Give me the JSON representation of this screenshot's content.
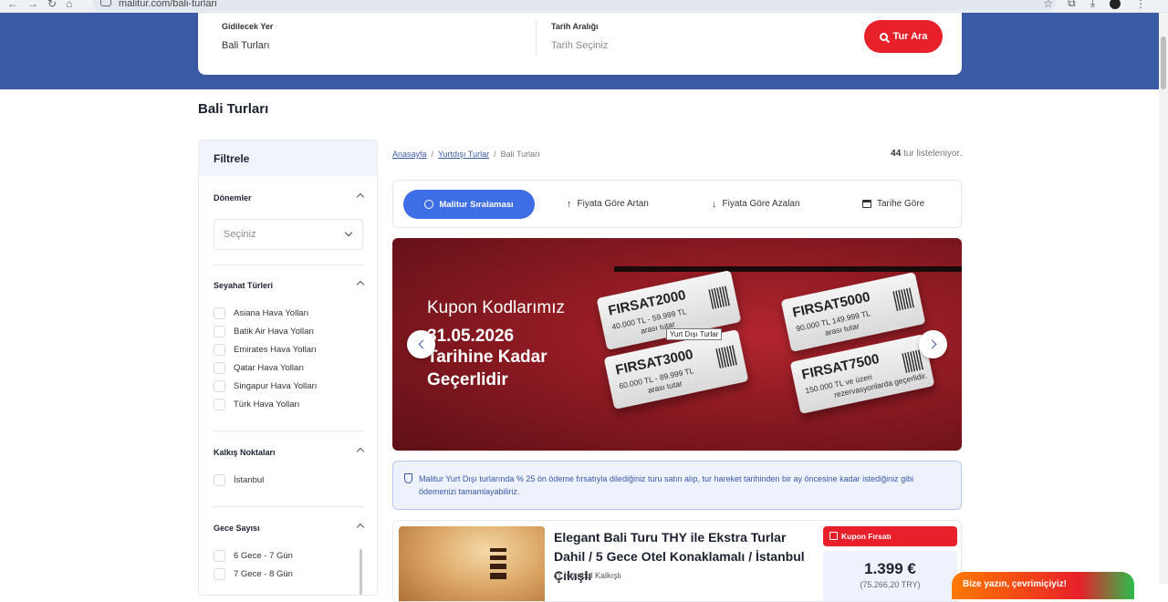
{
  "browser": {
    "url": "malitur.com/bali-turlari"
  },
  "search": {
    "destination_label": "Gidilecek Yer",
    "destination_value": "Bali Turları",
    "date_label": "Tarih Aralığı",
    "date_placeholder": "Tarih Seçiniz",
    "button_label": "Tur Ara"
  },
  "page": {
    "title": "Bali Turları"
  },
  "filters": {
    "heading": "Filtrele",
    "periods": {
      "title": "Dönemler",
      "select_placeholder": "Seçiniz"
    },
    "travel_types": {
      "title": "Seyahat Türleri",
      "options": [
        "Asiana Hava Yolları",
        "Batik Air Hava Yolları",
        "Emirates Hava Yolları",
        "Qatar Hava Yolları",
        "Singapur Hava Yolları",
        "Türk Hava Yolları"
      ]
    },
    "departure_points": {
      "title": "Kalkış Noktaları",
      "options": [
        "İstanbul"
      ]
    },
    "nights": {
      "title": "Gece Sayısı",
      "options": [
        "6 Gece - 7 Gün",
        "7 Gece - 8 Gün"
      ]
    }
  },
  "breadcrumb": {
    "home": "Anasayfa",
    "sep": "/",
    "abroad": "Yurtdışı Turlar",
    "current": "Bali Turları"
  },
  "results": {
    "count": "44",
    "suffix": "tur listeleniyor."
  },
  "sorting": {
    "active": "Malitur Sıralaması",
    "price_asc": "Fiyata Göre Artan",
    "price_desc": "Fiyata Göre Azalan",
    "by_date": "Tarihe Göre"
  },
  "banner": {
    "line1": "Kupon Kodlarımız",
    "line2": "31.05.2026",
    "line3": "Tarihine Kadar",
    "line4": "Geçerlidir",
    "tooltip": "Yurt Dışı Turlar",
    "coupons": [
      {
        "code": "FIRSAT2000",
        "range": "40.000 TL - 59.999 TL",
        "note": "arası tutar"
      },
      {
        "code": "FIRSAT3000",
        "range": "60.000 TL - 89.999 TL",
        "note": "arası tutar"
      },
      {
        "code": "FIRSAT5000",
        "range": "90.000 TL 149.999 TL",
        "note": "arası tutar"
      },
      {
        "code": "FIRSAT7500",
        "range": "150.000 TL ve üzeri",
        "note": "rezervasyonlarda geçerlidir."
      }
    ]
  },
  "info": {
    "text": "Malitur Yurt Dışı turlarında % 25 ön ödeme fırsatıyla dilediğiniz turu satın alıp, tur hareket tarihinden bir ay öncesine kadar istediğiniz gibi ödemenizi tamamlayabiliriz."
  },
  "tour": {
    "title": "Elegant Bali Turu THY ile Ekstra Turlar Dahil / 5 Gece Otel Konaklamalı / İstanbul Çıkışlı",
    "departure": "İstanbul Kalkışlı",
    "badge": "Kupon Fırsatı",
    "price": "1.399 €",
    "price_try": "(75.266,20 TRY)"
  },
  "chat": {
    "label": "Bize yazın, çevrimiçiyiz!"
  },
  "colors": {
    "brand_blue": "#3c5ba6",
    "accent_red": "#e8202a",
    "sort_blue": "#3e6ee6"
  }
}
